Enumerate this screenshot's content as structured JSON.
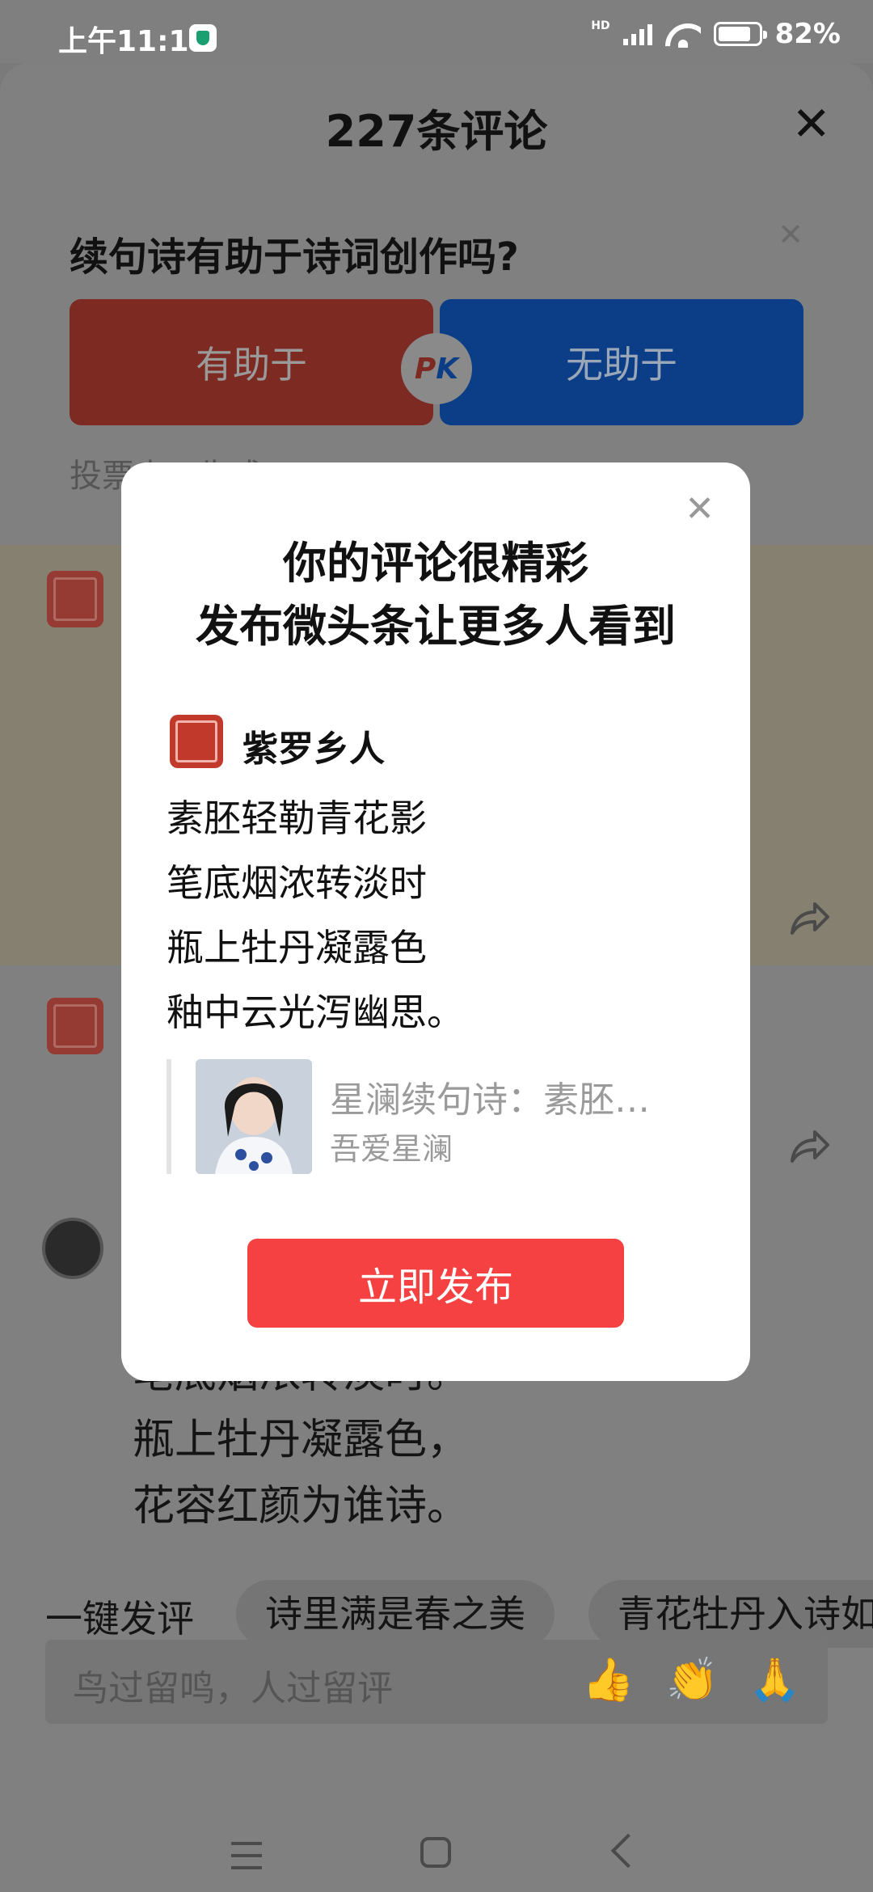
{
  "status_bar": {
    "time": "上午11:11",
    "hd": "HD",
    "battery": "82%",
    "battery_level": 0.82
  },
  "sheet": {
    "title": "227条评论"
  },
  "poll": {
    "question": "续句诗有助于诗词创作吗?",
    "yes_label": "有助于",
    "no_label": "无助于",
    "pk_p": "P",
    "pk_k": "K",
    "note": "投票由AI生成"
  },
  "background_comment": {
    "lines": [
      "笔底烟浓转淡时。",
      "瓶上牡丹凝露色，",
      "花容红颜为谁诗。"
    ]
  },
  "suggest": {
    "label": "一键发评",
    "chips": [
      "诗里满是春之美",
      "青花牡丹入诗如"
    ]
  },
  "input": {
    "placeholder": "鸟过留鸣，人过留评",
    "emojis": [
      "👍",
      "👏",
      "🙏"
    ]
  },
  "modal": {
    "title_line1": "你的评论很精彩",
    "title_line2": "发布微头条让更多人看到",
    "username": "紫罗乡人",
    "poem": [
      "素胚轻勒青花影",
      "笔底烟浓转淡时",
      "瓶上牡丹凝露色",
      "釉中云光泻幽思。"
    ],
    "quote_title": "星澜续句诗：素胚…",
    "quote_author": "吾爱星澜",
    "publish_button": "立即发布"
  },
  "colors": {
    "primary": "#f54141",
    "yes": "#d32f2f",
    "no": "#1565c0"
  }
}
